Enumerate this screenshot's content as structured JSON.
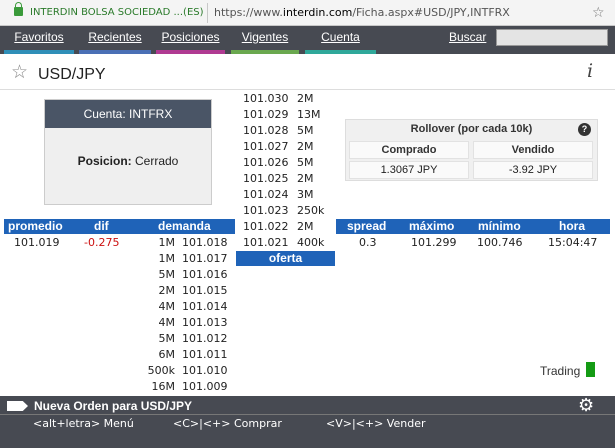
{
  "browser": {
    "site_label": "INTERDIN BOLSA SOCIEDAD ...(ES)",
    "url_prefix": "https://www.",
    "url_domain": "interdin.com",
    "url_path": "/Ficha.aspx#USD/JPY,INTFRX"
  },
  "nav": {
    "items": [
      {
        "label": "Favoritos",
        "color": "#2f8fb8"
      },
      {
        "label": "Recientes",
        "color": "#4a6fb5"
      },
      {
        "label": "Posiciones",
        "color": "#b03a92"
      },
      {
        "label": "Vigentes",
        "color": "#6aa84f"
      },
      {
        "label": "Cuenta",
        "color": "#2fa89a"
      }
    ],
    "search_label": "Buscar"
  },
  "title": {
    "symbol": "USD/JPY",
    "info_glyph": "i"
  },
  "account": {
    "header": "Cuenta: INTFRX",
    "position_label": "Posicion:",
    "position_value": "Cerrado"
  },
  "offers": [
    {
      "price": "101.030",
      "size": "2M"
    },
    {
      "price": "101.029",
      "size": "13M"
    },
    {
      "price": "101.028",
      "size": "5M"
    },
    {
      "price": "101.027",
      "size": "2M"
    },
    {
      "price": "101.026",
      "size": "5M"
    },
    {
      "price": "101.025",
      "size": "2M"
    },
    {
      "price": "101.024",
      "size": "3M"
    },
    {
      "price": "101.023",
      "size": "250k"
    },
    {
      "price": "101.022",
      "size": "2M"
    },
    {
      "price": "101.021",
      "size": "400k"
    }
  ],
  "rollover": {
    "title": "Rollover (por cada 10k)",
    "bought_label": "Comprado",
    "sold_label": "Vendido",
    "bought_value": "1.3067 JPY",
    "sold_value": "-3.92 JPY"
  },
  "quote_left": {
    "headers": {
      "promedio": "promedio",
      "dif": "dif",
      "demanda": "demanda"
    },
    "promedio": "101.019",
    "dif": "-0.275"
  },
  "oferta_label": "oferta",
  "quote_right": {
    "headers": {
      "spread": "spread",
      "max": "máximo",
      "min": "mínimo",
      "hora": "hora"
    },
    "spread": "0.3",
    "max": "101.299",
    "min": "100.746",
    "hora": "15:04:47"
  },
  "bids": [
    {
      "size": "1M",
      "price": "101.018"
    },
    {
      "size": "1M",
      "price": "101.017"
    },
    {
      "size": "5M",
      "price": "101.016"
    },
    {
      "size": "2M",
      "price": "101.015"
    },
    {
      "size": "4M",
      "price": "101.014"
    },
    {
      "size": "4M",
      "price": "101.013"
    },
    {
      "size": "5M",
      "price": "101.012"
    },
    {
      "size": "6M",
      "price": "101.011"
    },
    {
      "size": "500k",
      "price": "101.010"
    },
    {
      "size": "16M",
      "price": "101.009"
    }
  ],
  "trading_label": "Trading",
  "trading_color": "#149b14",
  "order_bar": {
    "title": "Nueva Orden para USD/JPY",
    "hint_menu": "<alt+letra> Menú",
    "hint_buy": "<C>|<+> Comprar",
    "hint_sell": "<V>|<+> Vender"
  }
}
